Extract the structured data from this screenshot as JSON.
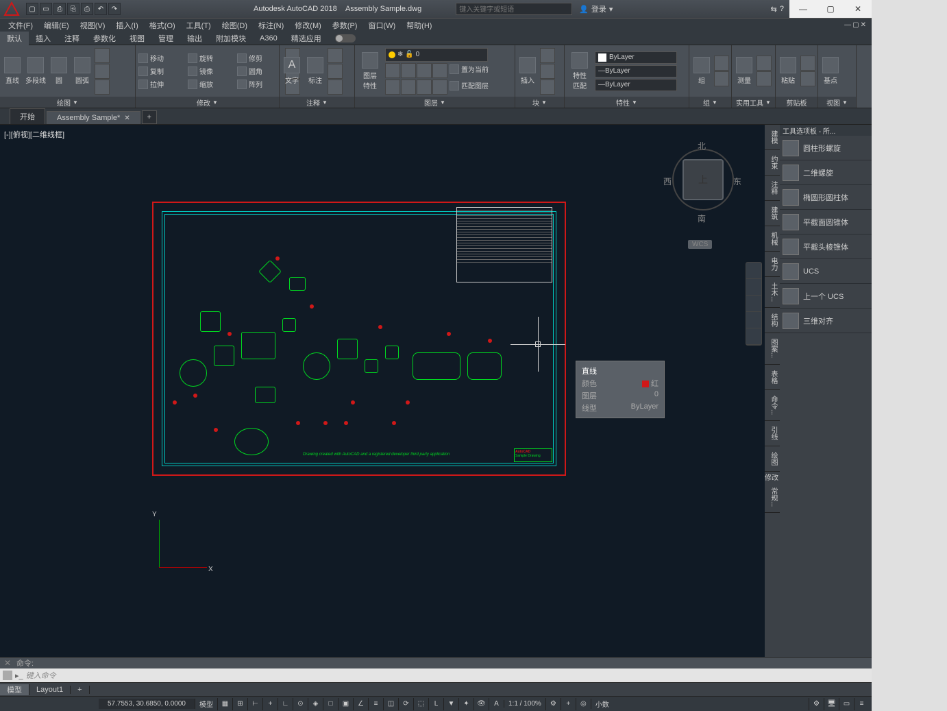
{
  "title": {
    "app": "Autodesk AutoCAD 2018",
    "file": "Assembly Sample.dwg"
  },
  "search_placeholder": "键入关键字或短语",
  "signin": "登录",
  "menubar": [
    "文件(F)",
    "编辑(E)",
    "视图(V)",
    "插入(I)",
    "格式(O)",
    "工具(T)",
    "绘图(D)",
    "标注(N)",
    "修改(M)",
    "参数(P)",
    "窗口(W)",
    "帮助(H)"
  ],
  "ribbon_tabs": [
    "默认",
    "插入",
    "注释",
    "参数化",
    "视图",
    "管理",
    "输出",
    "附加模块",
    "A360",
    "精选应用"
  ],
  "panels": {
    "draw": {
      "label": "绘图",
      "items": [
        "直线",
        "多段线",
        "圆",
        "圆弧"
      ]
    },
    "modify": {
      "label": "修改",
      "items": [
        "移动",
        "复制",
        "拉伸",
        "旋转",
        "镜像",
        "缩放",
        "修剪",
        "圆角",
        "阵列"
      ]
    },
    "annot": {
      "label": "注释",
      "items": [
        "文字",
        "标注"
      ]
    },
    "layer": {
      "label": "图层",
      "big": "图层\n特性",
      "current": "0",
      "btns": [
        "置为当前",
        "匹配图层"
      ]
    },
    "block": {
      "label": "块",
      "big": "插入"
    },
    "props": {
      "label": "特性",
      "big": "特性\n匹配",
      "bylayer": "ByLayer"
    },
    "group": {
      "label": "组",
      "big": "组"
    },
    "util": {
      "label": "实用工具",
      "big": "测量"
    },
    "clip": {
      "label": "剪贴板",
      "big": "粘贴"
    },
    "view": {
      "label": "视图",
      "big": "基点"
    }
  },
  "file_tabs": {
    "start": "开始",
    "active": "Assembly Sample*"
  },
  "viewport_label": "[-][俯视][二维线框]",
  "navcube": {
    "top": "上",
    "n": "北",
    "s": "南",
    "e": "东",
    "w": "西",
    "wcs": "WCS"
  },
  "tooltip": {
    "title": "直线",
    "rows": [
      [
        "颜色",
        "红"
      ],
      [
        "图层",
        "0"
      ],
      [
        "线型",
        "ByLayer"
      ]
    ]
  },
  "ucs": {
    "x": "X",
    "y": "Y"
  },
  "drawing": {
    "note": "Drawing created with AutoCAD and a registered developer third party application",
    "tb1": "AutoCAD",
    "tb2": "Sample Drawing"
  },
  "right_tabs": [
    "建模",
    "约束",
    "注释",
    "建筑",
    "机械",
    "电力",
    "土木...",
    "结构",
    "图案...",
    "表格",
    "命令...",
    "引线",
    "绘图",
    "修改",
    "常规..."
  ],
  "toolpalette": {
    "title": "工具选项板 - 所...",
    "items": [
      "圆柱形螺旋",
      "二维螺旋",
      "椭圆形圆柱体",
      "平截面圆锥体",
      "平截头棱锥体",
      "UCS",
      "上一个 UCS",
      "三维对齐"
    ]
  },
  "cmd": {
    "hist": "命令:",
    "placeholder": "键入命令"
  },
  "layout_tabs": [
    "模型",
    "Layout1"
  ],
  "status": {
    "coord": "57.7553, 30.6850, 0.0000",
    "model": "模型",
    "scale": "1:1 / 100%",
    "dec": "小数"
  }
}
